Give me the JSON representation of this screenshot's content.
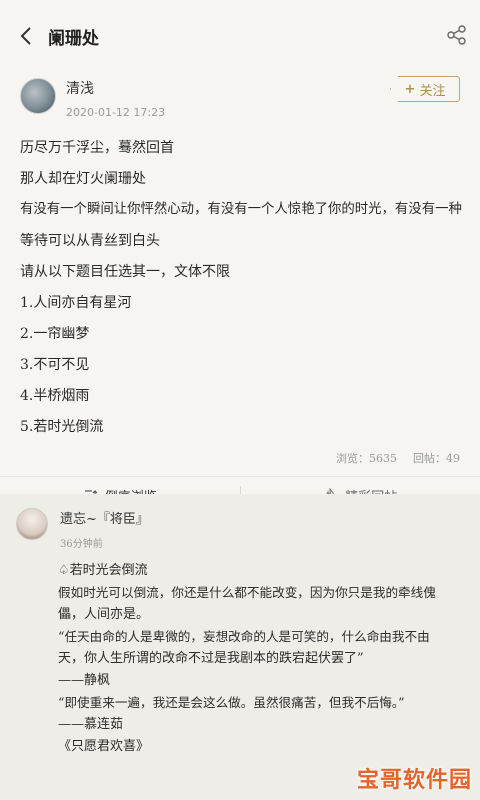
{
  "header": {
    "title": "阑珊处"
  },
  "post": {
    "author": "清浅",
    "date": "2020-01-12 17:23",
    "follow_label": "关注",
    "lines": [
      "历尽万千浮尘，蓦然回首",
      "那人却在灯火阑珊处",
      "有没有一个瞬间让你怦然心动，有没有一个人惊艳了你的时光，有没有一种",
      "等待可以从青丝到白头",
      "请从以下题目任选其一，文体不限",
      "1.人间亦自有星河",
      "2.一帘幽梦",
      "3.不可不见",
      "4.半桥烟雨",
      "5.若时光倒流"
    ],
    "views": "浏览：5635",
    "replies": "回帖：49"
  },
  "tabs": {
    "reverse_label": "倒序浏览",
    "featured_label": "精彩回帖"
  },
  "reply": {
    "author": "遗忘~『将臣』",
    "time": "36分钟前",
    "lines": [
      "♤若时光会倒流",
      "假如时光可以倒流，你还是什么都不能改变，因为你只是我的牵线傀",
      "儡，人间亦是。",
      "“任天由命的人是卑微的，妄想改命的人是可笑的，什么命由我不由",
      "天，你人生所谓的改命不过是我剧本的跌宕起伏罢了”",
      "——静枫",
      "“即使重来一遍，我还是会这么做。虽然很痛苦，但我不后悔。”",
      "——慕连茹",
      "《只愿君欢喜》"
    ]
  },
  "watermark": "宝哥软件园"
}
